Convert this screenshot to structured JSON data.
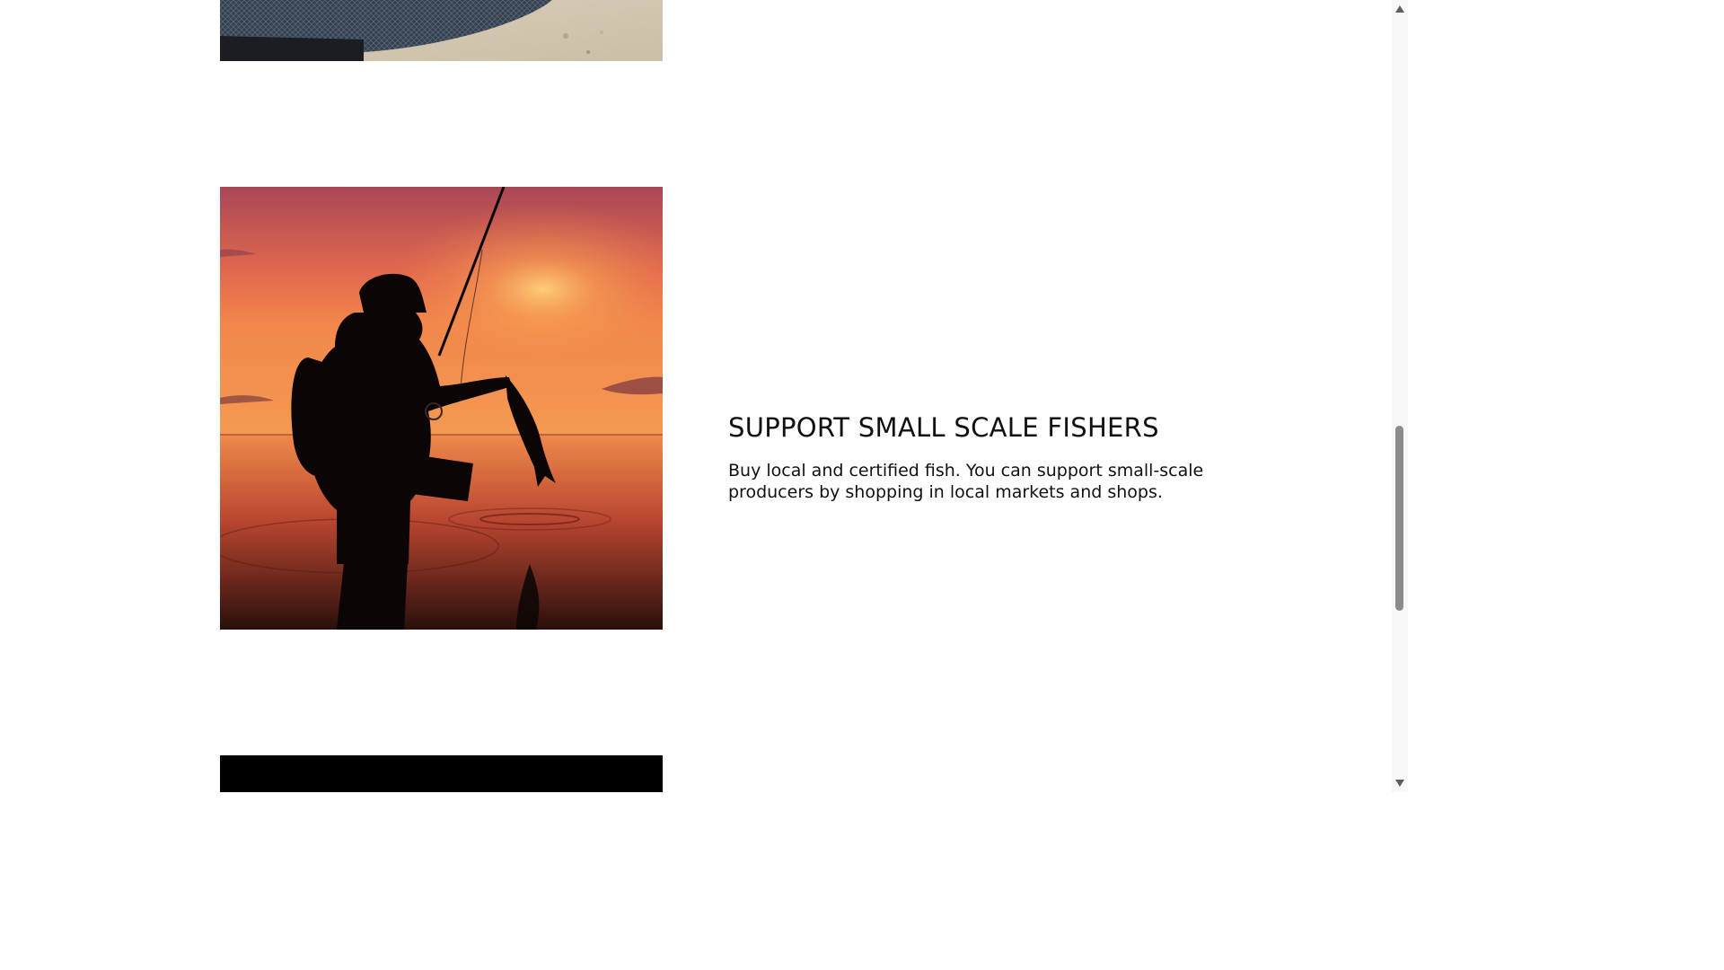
{
  "section": {
    "title": "SUPPORT SMALL SCALE FISHERS",
    "body": "Buy local and certified fish. You can support small-scale producers by shopping in local markets and shops."
  },
  "images": {
    "top": {
      "icon": "fishing-net-photo"
    },
    "feature": {
      "icon": "fisher-silhouette-sunset-photo"
    },
    "bottom": {
      "icon": "dark-photo"
    }
  },
  "scrollbar": {
    "up_icon": "triangle-up-icon",
    "down_icon": "triangle-down-icon",
    "position_fraction": 0.54
  },
  "colors": {
    "text": "#111111",
    "background": "#ffffff",
    "sunset_top": "#b04d5a",
    "sunset_mid": "#f0804c",
    "sunset_horizon": "#f6a35b"
  }
}
